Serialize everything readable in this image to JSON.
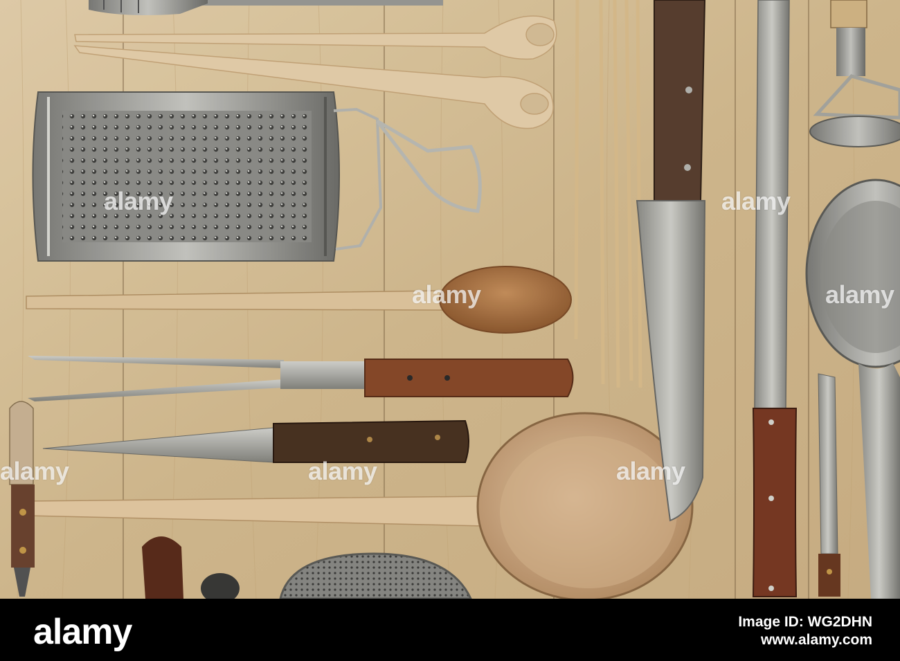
{
  "photo": {
    "subject": "Kitchen utensils laid out on light wooden planks",
    "colors": {
      "wood": "#d9c19a",
      "metal": "#9a9a96",
      "handle": "#6b3a22"
    }
  },
  "watermark": {
    "text": "alamy"
  },
  "footer": {
    "brand": "alamy",
    "image_id": "Image ID: WG2DHN",
    "url": "www.alamy.com",
    "background": "#000000"
  }
}
